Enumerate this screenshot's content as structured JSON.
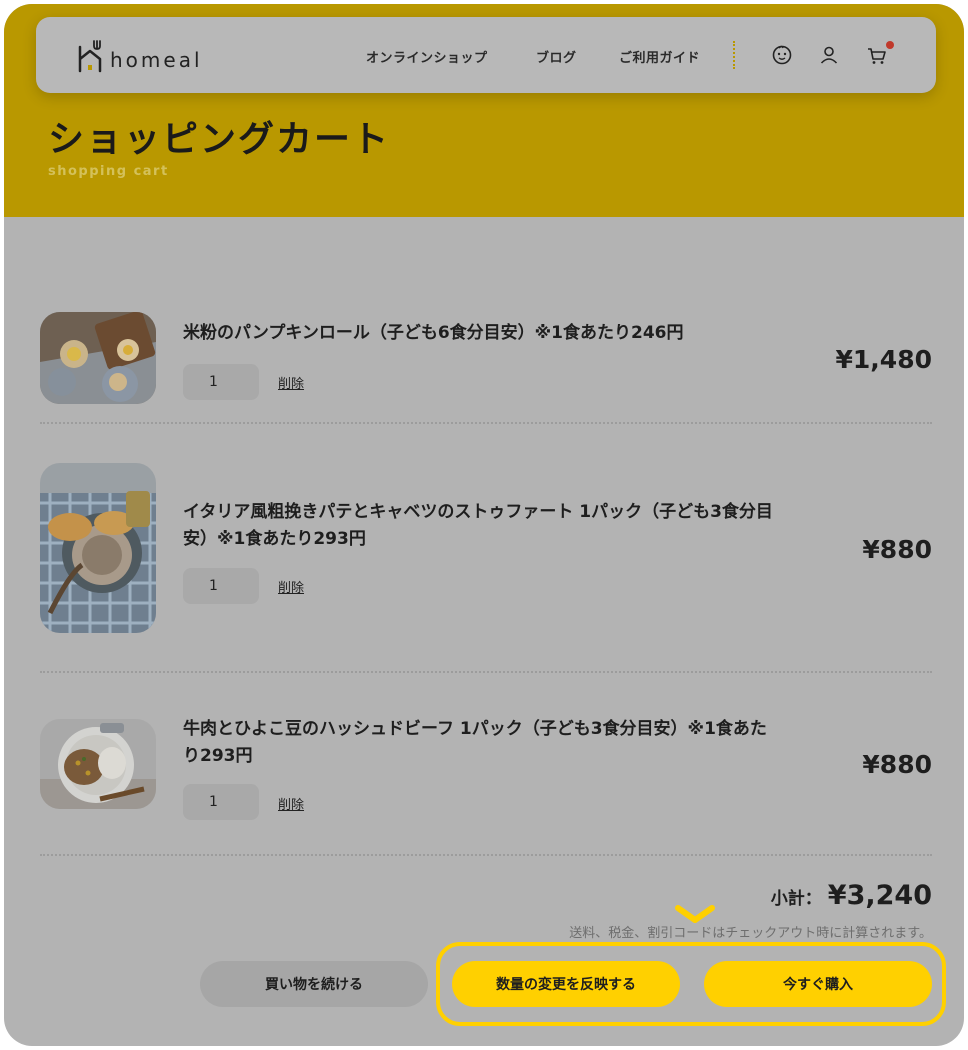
{
  "brand": {
    "name": "homeal"
  },
  "nav": {
    "links": [
      "オンラインショップ",
      "ブログ",
      "ご利用ガイド"
    ],
    "icons": [
      "baby-face-icon",
      "user-icon",
      "cart-icon"
    ]
  },
  "page": {
    "title": "ショッピングカート",
    "subtitle": "shopping cart"
  },
  "cart": {
    "items": [
      {
        "name": "米粉のパンプキンロール（子ども6食分目安）※1食あたり246円",
        "quantity": "1",
        "remove_label": "削除",
        "price": "¥1,480"
      },
      {
        "name": "イタリア風粗挽きパテとキャベツのストゥファート 1パック（子ども3食分目安）※1食あたり293円",
        "quantity": "1",
        "remove_label": "削除",
        "price": "¥880"
      },
      {
        "name": "牛肉とひよこ豆のハッシュドビーフ 1パック（子ども3食分目安）※1食あたり293円",
        "quantity": "1",
        "remove_label": "削除",
        "price": "¥880"
      }
    ],
    "subtotal_label": "小計：",
    "subtotal_value": "¥3,240",
    "note": "送料、税金、割引コードはチェックアウト時に計算されます。"
  },
  "actions": {
    "continue_label": "買い物を続ける",
    "update_label": "数量の変更を反映する",
    "buy_label": "今すぐ購入"
  },
  "colors": {
    "accent": "#ffd000",
    "header_bg": "#b99800",
    "overlay": "#b3b3b3",
    "badge": "#c0392b"
  }
}
